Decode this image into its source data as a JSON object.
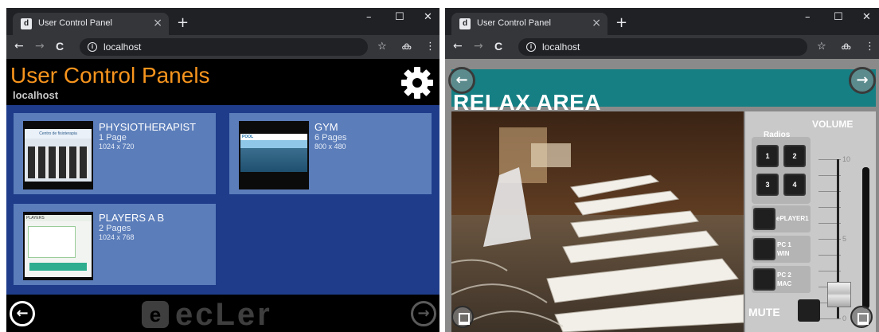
{
  "left_window": {
    "tab": {
      "title": "User Control Panel",
      "favicon": "ecler-favicon",
      "close_glyph": "×"
    },
    "new_tab_glyph": "+",
    "window_controls": {
      "minimize": "–",
      "maximize": "☐",
      "close": "✕"
    },
    "toolbar": {
      "back": "←",
      "forward": "→",
      "reload": "C",
      "info": "i",
      "url": "localhost",
      "bookmark": "☆",
      "extension": "ക",
      "menu": "⋮"
    },
    "page": {
      "title": "User Control Panels",
      "subtitle": "localhost",
      "settings_icon": "gear-icon",
      "panels": [
        {
          "name": "PHYSIOTHERAPIST",
          "pages": "1 Page",
          "resolution": "1024 x 720",
          "thumb_caption": "Centro de fisioterapia"
        },
        {
          "name": "GYM",
          "pages": "6 Pages",
          "resolution": "800 x 480",
          "thumb_caption": "POOL"
        },
        {
          "name": "PLAYERS A B",
          "pages": "2 Pages",
          "resolution": "1024 x 768",
          "thumb_caption": "PLAYERS"
        }
      ],
      "footer": {
        "back_glyph": "←",
        "forward_glyph": "→",
        "logo_mark": "e",
        "logo_text": "ecLer"
      }
    }
  },
  "right_window": {
    "tab": {
      "title": "User Control Panel",
      "favicon": "ecler-favicon",
      "close_glyph": "×"
    },
    "new_tab_glyph": "+",
    "window_controls": {
      "minimize": "–",
      "maximize": "☐",
      "close": "✕"
    },
    "toolbar": {
      "back": "←",
      "forward": "→",
      "reload": "C",
      "info": "i",
      "url": "localhost",
      "bookmark": "☆",
      "extension": "ക",
      "menu": "⋮"
    },
    "page": {
      "title": "RELAX AREA",
      "volume_label": "VOLUME",
      "radios_label": "Radios",
      "radio_buttons": [
        "1",
        "2",
        "3",
        "4"
      ],
      "sources": [
        {
          "label_line1": "ePLAYER1",
          "label_line2": ""
        },
        {
          "label_line1": "PC 1",
          "label_line2": "WIN"
        },
        {
          "label_line1": "PC 2",
          "label_line2": "MAC"
        }
      ],
      "mute_label": "MUTE",
      "fader_scale": [
        "10",
        "5",
        "0"
      ],
      "fader_level": 0.15,
      "nav_back": "←",
      "nav_forward": "→"
    }
  },
  "colors": {
    "accent_orange": "#f7941d",
    "panel_blue": "#1e3c8a",
    "card_blue": "#5b7dba",
    "teal": "#157f84"
  }
}
